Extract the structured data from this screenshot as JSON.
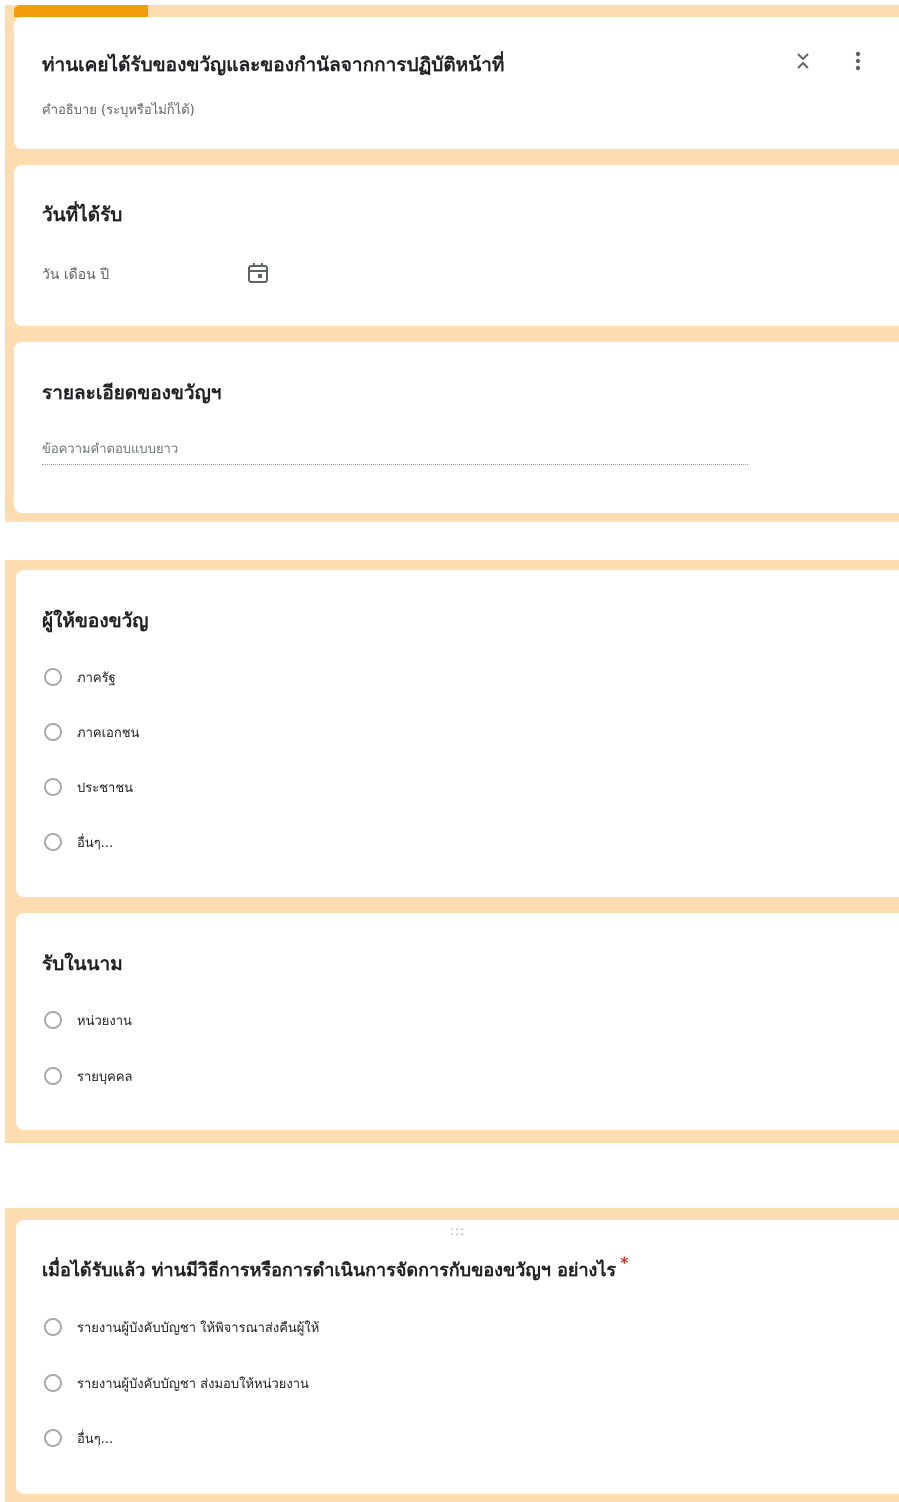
{
  "colors": {
    "band": "#fddcb0",
    "accent": "#f29d0a",
    "required": "#d93025"
  },
  "section": {
    "title": "ท่านเคยได้รับของขวัญและของกำนัลจากการปฏิบัติหน้าที่",
    "description": "คำอธิบาย (ระบุหรือไม่ก็ได้)",
    "icons": [
      "collapse-section-icon",
      "more-vert-icon"
    ]
  },
  "q_date": {
    "title": "วันที่ได้รับ",
    "placeholder": "วัน เดือน ปี",
    "icon": "calendar-icon"
  },
  "q_details": {
    "title": "รายละเอียดของขวัญฯ",
    "placeholder": "ข้อความคำตอบแบบยาว"
  },
  "q_giver": {
    "title": "ผู้ให้ของขวัญ",
    "options": [
      "ภาครัฐ",
      "ภาคเอกชน",
      "ประชาชน",
      "อื่นๆ..."
    ]
  },
  "q_received_as": {
    "title": "รับในนาม",
    "options": [
      "หน่วยงาน",
      "รายบุคคล"
    ]
  },
  "q_action": {
    "title": "เมื่อได้รับแล้ว ท่านมีวิธีการหรือการดำเนินการจัดการกับของขวัญฯ อย่างไร",
    "required_mark": "*",
    "drag_handle": ":::",
    "options": [
      "รายงานผู้บังคับบัญชา ให้พิจารณาส่งคืนผู้ให้",
      "รายงานผู้บังคับบัญชา ส่งมอบให้หน่วยงาน",
      "อื่นๆ..."
    ]
  }
}
